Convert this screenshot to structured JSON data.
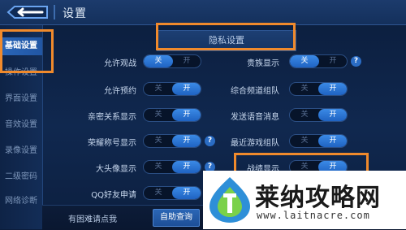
{
  "header": {
    "title": "设置"
  },
  "sidebar": {
    "items": [
      {
        "label": "基础设置",
        "active": true
      },
      {
        "label": "操作设置",
        "active": false
      },
      {
        "label": "界面设置",
        "active": false
      },
      {
        "label": "音效设置",
        "active": false
      },
      {
        "label": "录像设置",
        "active": false
      },
      {
        "label": "二级密码",
        "active": false
      },
      {
        "label": "网络诊断",
        "active": false
      }
    ]
  },
  "section": {
    "title": "隐私设置"
  },
  "toggle_labels": {
    "off": "关",
    "on": "开"
  },
  "left_settings": [
    {
      "label": "允许观战",
      "state": "off",
      "help": false
    },
    {
      "label": "允许预约",
      "state": "on",
      "help": false
    },
    {
      "label": "亲密关系显示",
      "state": "on",
      "help": false
    },
    {
      "label": "荣耀称号显示",
      "state": "on",
      "help": true
    },
    {
      "label": "大头像显示",
      "state": "on",
      "help": true
    },
    {
      "label": "QQ好友申请",
      "state": "on",
      "help": false
    }
  ],
  "right_settings": [
    {
      "label": "贵族显示",
      "state": "off",
      "help": true
    },
    {
      "label": "综合频道组队",
      "state": "on",
      "help": false
    },
    {
      "label": "发送语音消息",
      "state": "on",
      "help": false
    },
    {
      "label": "最近游戏组队",
      "state": "on",
      "help": false
    },
    {
      "label": "战绩显示",
      "state": "on",
      "help": false
    }
  ],
  "help_icon_glyph": "?",
  "bottom": {
    "prompt": "有困难请点我",
    "button": "自助查询"
  },
  "watermark": {
    "name": "莱纳攻略网",
    "url": "www.laitnacre.com"
  },
  "colors": {
    "accent": "#2a66b8",
    "highlight": "#f08a2c",
    "toggle_on": "#3b8ae6"
  }
}
